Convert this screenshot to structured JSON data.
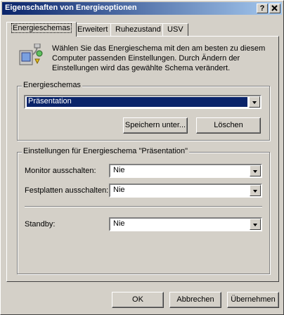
{
  "window": {
    "title": "Eigenschaften von Energieoptionen",
    "help_btn": "?",
    "close_btn": "X"
  },
  "tabs": [
    {
      "label": "Energieschemas"
    },
    {
      "label": "Erweitert"
    },
    {
      "label": "Ruhezustand"
    },
    {
      "label": "USV"
    }
  ],
  "description": "Wählen Sie das Energieschema mit den am besten zu diesem Computer passenden Einstellungen. Durch Ändern der Einstellungen wird das gewählte Schema verändert.",
  "schemes_group": {
    "title": "Energieschemas",
    "selected": "Präsentation",
    "save_as": "Speichern unter...",
    "delete": "Löschen"
  },
  "settings_group": {
    "title": "Einstellungen für Energieschema \"Präsentation\"",
    "monitor_label": "Monitor ausschalten:",
    "monitor_value": "Nie",
    "harddisk_label": "Festplatten ausschalten:",
    "harddisk_value": "Nie",
    "standby_label": "Standby:",
    "standby_value": "Nie"
  },
  "footer": {
    "ok": "OK",
    "cancel": "Abbrechen",
    "apply": "Übernehmen"
  }
}
